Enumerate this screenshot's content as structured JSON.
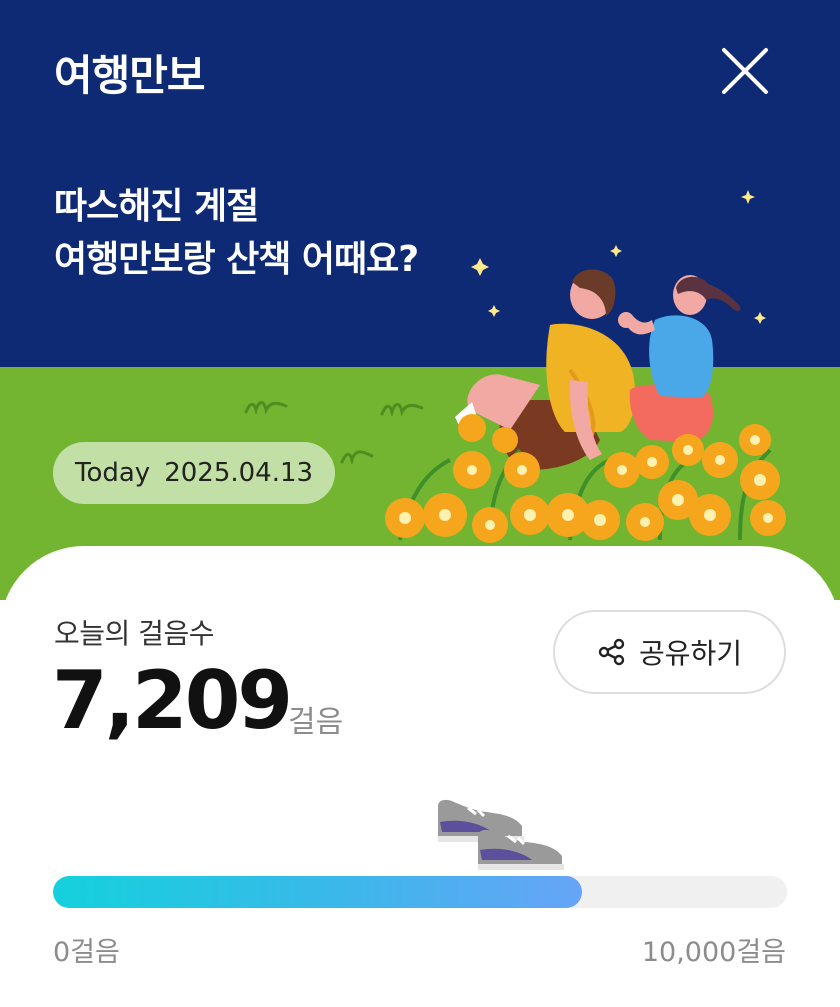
{
  "header": {
    "title": "여행만보",
    "close_icon": "close-icon"
  },
  "banner": {
    "headline_line1": "따스해진 계절",
    "headline_line2": "여행만보랑 산책 어때요?",
    "date_label": "Today",
    "date_value": "2025.04.13"
  },
  "steps": {
    "label": "오늘의 걸음수",
    "value": "7,209",
    "unit": "걸음",
    "share_label": "공유하기",
    "share_icon": "share-icon"
  },
  "progress": {
    "current": 7209,
    "goal": 10000,
    "min_label": "0걸음",
    "max_label": "10,000걸음",
    "indicator_icon": "sneakers-icon"
  },
  "colors": {
    "hero_bg": "#0f2a75",
    "grass": "#73b531",
    "progress_start": "#14d1dc",
    "progress_end": "#67a4f7"
  }
}
